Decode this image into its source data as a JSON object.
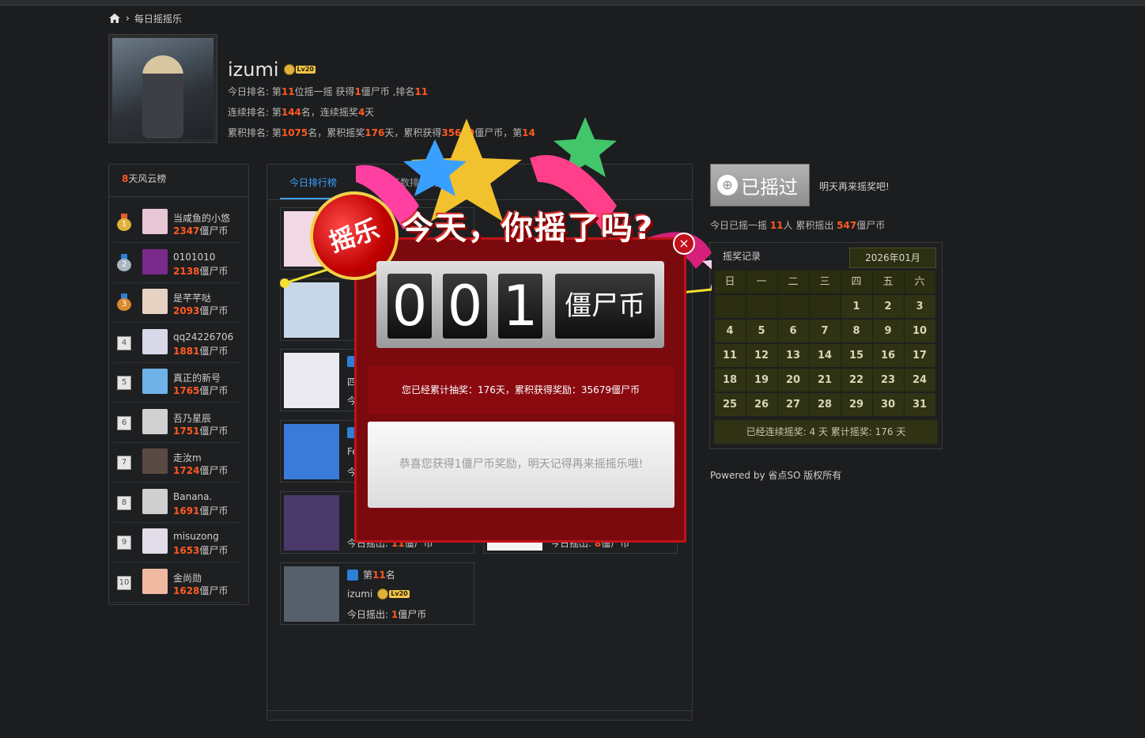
{
  "breadcrumb": {
    "page": "每日摇摇乐"
  },
  "profile": {
    "name": "izumi",
    "level": "Lv20",
    "today_prefix": "今日排名: 第",
    "today_rank": "11",
    "today_mid": "位摇一摇 获得",
    "today_coins": "1",
    "today_mid2": "僵尸币 ,排名",
    "today_rank2": "11",
    "streak_prefix": "连续排名: 第",
    "streak_rank": "144",
    "streak_mid": "名，连续摇奖",
    "streak_days": "4",
    "streak_suffix": "天",
    "total_prefix": "累积排名: 第",
    "total_rank": "1075",
    "total_mid": "名，累积摇奖",
    "total_days": "176",
    "total_mid2": "天，累积获得",
    "total_coins": "35679",
    "total_mid3": "僵尸币，第",
    "total_rank2": "14"
  },
  "leaderboard": {
    "title_num": "8",
    "title_text": "天风云榜",
    "coin_unit": "僵尸币",
    "items": [
      {
        "rank": "1",
        "name": "当咸鱼的小悠",
        "coins": "2347",
        "medal": "gold",
        "avatar_color": "#e8c7d4"
      },
      {
        "rank": "2",
        "name": "0101010",
        "coins": "2138",
        "medal": "silver",
        "avatar_color": "#7a2a8a"
      },
      {
        "rank": "3",
        "name": "是芊芊哒",
        "coins": "2093",
        "medal": "bronze",
        "avatar_color": "#e6d2c2"
      },
      {
        "rank": "4",
        "name": "qq24226706",
        "coins": "1881",
        "avatar_color": "#d8d8e8"
      },
      {
        "rank": "5",
        "name": "真正的新号",
        "coins": "1765",
        "avatar_color": "#6fb2e8"
      },
      {
        "rank": "6",
        "name": "吾乃星辰",
        "coins": "1751",
        "avatar_color": "#d0d0d0"
      },
      {
        "rank": "7",
        "name": "走汝m",
        "coins": "1724",
        "avatar_color": "#5a4a44"
      },
      {
        "rank": "8",
        "name": "Banana.",
        "coins": "1691",
        "avatar_color": "#cfcfcf"
      },
      {
        "rank": "9",
        "name": "misuzong",
        "coins": "1653",
        "avatar_color": "#e2dde8"
      },
      {
        "rank": "10",
        "name": "金尚勋",
        "coins": "1628",
        "avatar_color": "#f0b9a2"
      }
    ]
  },
  "center": {
    "tabs": [
      "今日排行榜",
      "连续天数排行榜"
    ],
    "cards": [
      {
        "rank": "",
        "user": "",
        "today": "",
        "avatar_color": "#f0d8e4"
      },
      {
        "rank": "",
        "user": "",
        "today": "",
        "avatar_color": "#c8d8e8"
      },
      {
        "rank": "",
        "user": "四",
        "today": "今",
        "avatar_color": "#eaeaf0"
      },
      {
        "rank": "",
        "user": "Fe",
        "today": "今",
        "avatar_color": "#3a7ad8"
      },
      {
        "rank": "",
        "user": "",
        "today_prefix": "今日摇出: ",
        "today_num": "11",
        "today_suffix": "僵尸币",
        "avatar_color": "#4a3a6a"
      },
      {
        "rank": "",
        "user": "",
        "today_prefix": "今日摇出: ",
        "today_num": "8",
        "today_suffix": "僵尸币",
        "avatar_color": "#f4f4f4"
      },
      {
        "rank_prefix": "第",
        "rank": "11",
        "rank_suffix": "名",
        "user": "izumi",
        "level": "Lv20",
        "today_prefix": "今日摇出: ",
        "today_num": "1",
        "today_suffix": "僵尸币",
        "avatar_color": "#55606a"
      }
    ]
  },
  "right": {
    "shaken_label": "已摇过",
    "tomorrow": "明天再来摇奖吧!",
    "today_stat_prefix": "今日已摇一摇 ",
    "today_count": "11",
    "today_stat_mid": "人 累积摇出 ",
    "today_total": "547",
    "today_stat_suffix": "僵尸币",
    "calendar_title": "摇奖记录",
    "month": "2026年01月",
    "weekdays": [
      "日",
      "一",
      "二",
      "三",
      "四",
      "五",
      "六"
    ],
    "weeks": [
      [
        "",
        "",
        "",
        "",
        "1",
        "2",
        "3"
      ],
      [
        "4",
        "5",
        "6",
        "7",
        "8",
        "9",
        "10"
      ],
      [
        "11",
        "12",
        "13",
        "14",
        "15",
        "16",
        "17"
      ],
      [
        "18",
        "19",
        "20",
        "21",
        "22",
        "23",
        "24"
      ],
      [
        "25",
        "26",
        "27",
        "28",
        "29",
        "30",
        "31"
      ]
    ],
    "footer": "已经连续摇奖:   4 天  累计摇奖:   176 天",
    "powered": "Powered by 省点SO 版权所有"
  },
  "popup": {
    "badge": "摇乐",
    "headline": "今天，你摇了吗?",
    "digits": [
      "0",
      "0",
      "1"
    ],
    "unit": "僵尸币",
    "total": "您已经累计抽奖：176天，累积获得奖励：35679僵尸币",
    "message": "恭喜您获得1僵尸币奖励，明天记得再来摇摇乐哦!",
    "close": "×",
    "colors": {
      "frame": "#c1121a",
      "body": "#7b0a0e",
      "accent": "#ff5a1f"
    }
  }
}
